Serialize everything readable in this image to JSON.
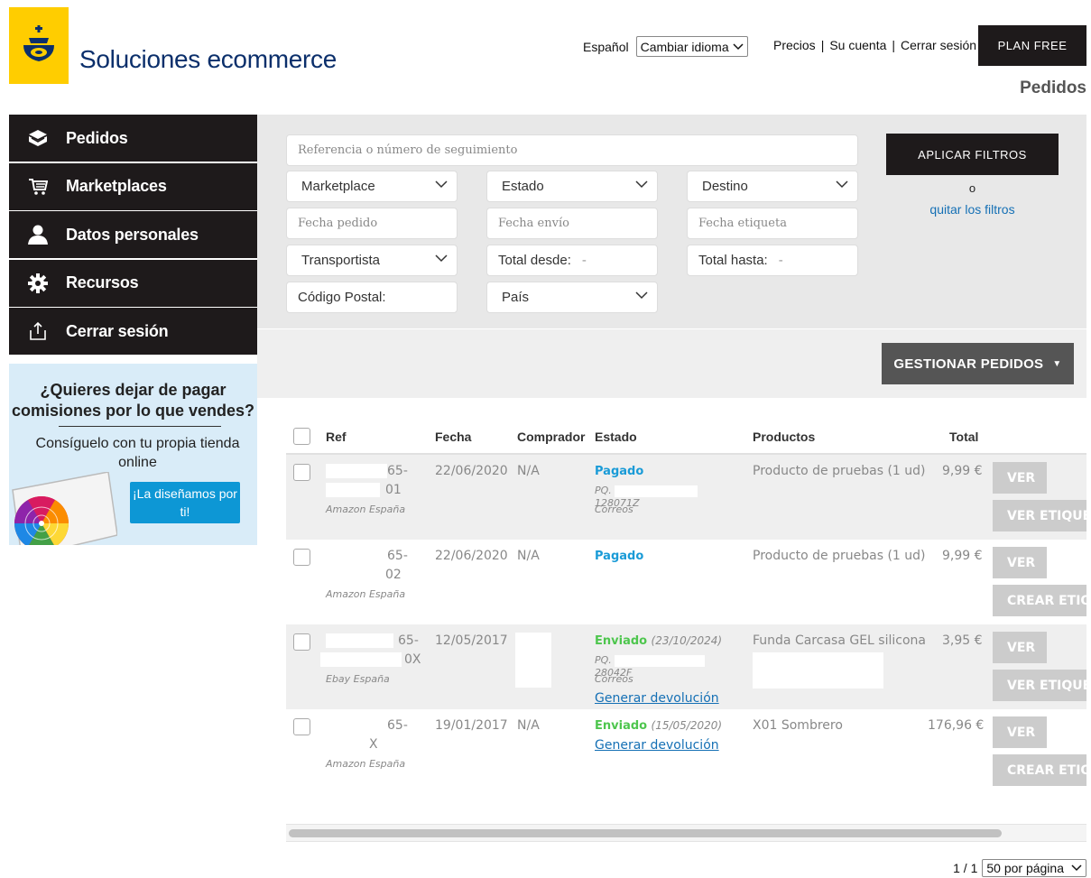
{
  "header": {
    "brand": "Soluciones ecommerce",
    "lang_label": "Español",
    "lang_select": "Cambiar idioma",
    "links": [
      "Precios",
      "Su cuenta",
      "Cerrar sesión"
    ],
    "plan_button": "PLAN FREE",
    "page_heading": "Pedidos",
    "brand_color": "#ffcd00"
  },
  "sidebar": {
    "items": [
      {
        "label": "Pedidos",
        "icon": "box-icon"
      },
      {
        "label": "Marketplaces",
        "icon": "cart-icon"
      },
      {
        "label": "Datos personales",
        "icon": "user-icon"
      },
      {
        "label": "Recursos",
        "icon": "gear-icon"
      },
      {
        "label": "Cerrar sesión",
        "icon": "logout-icon"
      }
    ],
    "promo": {
      "question": "¿Quieres dejar de pagar comisiones por lo que vendes?",
      "subtitle": "Consíguelo con tu propia tienda online",
      "cta": "¡La diseñamos por ti!"
    }
  },
  "filters": {
    "search_placeholder": "Referencia o número de seguimiento",
    "marketplace": "Marketplace",
    "estado": "Estado",
    "destino": "Destino",
    "fecha_pedido": "Fecha pedido",
    "fecha_envio": "Fecha envío",
    "fecha_etiqueta": "Fecha etiqueta",
    "transportista": "Transportista",
    "total_desde": "Total desde:",
    "total_hasta": "Total hasta:",
    "dash": "-",
    "codigo_postal": "Código Postal:",
    "pais": "País",
    "apply_button": "APLICAR FILTROS",
    "or": "o",
    "clear_link": "quitar los filtros"
  },
  "manage": {
    "button": "GESTIONAR PEDIDOS"
  },
  "table": {
    "headers": [
      "Ref",
      "Fecha",
      "Comprador",
      "Estado",
      "Productos",
      "Total"
    ],
    "rows": [
      {
        "ref_a": "65-",
        "ref_b": "01",
        "marketplace": "Amazon España",
        "fecha": "22/06/2020",
        "comprador": "N/A",
        "estado": "Pagado",
        "estado_date": "",
        "tracking_a": "PQ.",
        "tracking_b": "128071Z",
        "carrier": "Correos",
        "link": "",
        "producto": "Producto de pruebas (1 ud)",
        "total": "9,99 €",
        "btn1": "VER",
        "btn2": "VER ETIQUETA"
      },
      {
        "ref_a": "65-",
        "ref_b": "02",
        "marketplace": "Amazon España",
        "fecha": "22/06/2020",
        "comprador": "N/A",
        "estado": "Pagado",
        "estado_date": "",
        "tracking_a": "",
        "tracking_b": "",
        "carrier": "",
        "link": "",
        "producto": "Producto de pruebas (1 ud)",
        "total": "9,99 €",
        "btn1": "VER",
        "btn2": "CREAR ETIQUETA"
      },
      {
        "ref_a": "65-",
        "ref_b": "0X",
        "marketplace": "Ebay España",
        "fecha": "12/05/2017",
        "comprador": "",
        "estado": "Enviado",
        "estado_date": "(23/10/2024)",
        "tracking_a": "PQ.",
        "tracking_b": "28042F",
        "carrier": "Correos",
        "link": "Generar devolución",
        "producto": "Funda Carcasa GEL silicona",
        "total": "3,95 €",
        "btn1": "VER",
        "btn2": "VER ETIQUETA"
      },
      {
        "ref_a": "65-",
        "ref_b": "X",
        "marketplace": "Amazon España",
        "fecha": "19/01/2017",
        "comprador": "N/A",
        "estado": "Enviado",
        "estado_date": "(15/05/2020)",
        "tracking_a": "",
        "tracking_b": "",
        "carrier": "",
        "link": "Generar devolución",
        "producto": "X01 Sombrero",
        "total": "176,96 €",
        "btn1": "VER",
        "btn2": "CREAR ETIQUETA"
      }
    ]
  },
  "pager": {
    "pages": "1 / 1",
    "per_page": "50 por página"
  }
}
